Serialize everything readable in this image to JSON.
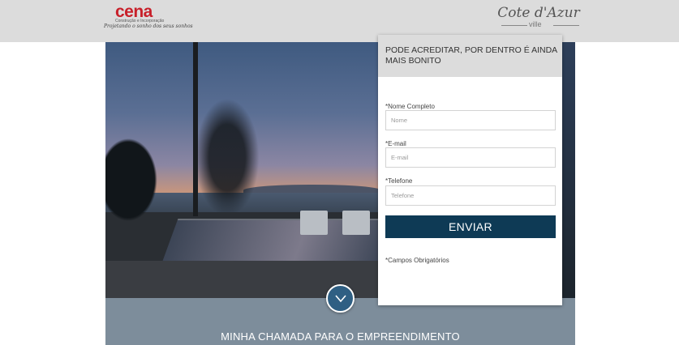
{
  "header": {
    "brand_left": {
      "name": "cena",
      "subtitle": "Construção e Incorporação",
      "tagline": "Projetando o sonho dos seus sonhos"
    },
    "brand_right": {
      "name": "Cote d'Azur",
      "sub": "ville"
    }
  },
  "form": {
    "title": "PODE ACREDITAR, POR DENTRO É AINDA MAIS BONITO",
    "fields": [
      {
        "label": "*Nome Completo",
        "placeholder": "Nome"
      },
      {
        "label": "*E-mail",
        "placeholder": "E-mail"
      },
      {
        "label": "*Telefone",
        "placeholder": "Telefone"
      }
    ],
    "submit_label": "ENVIAR",
    "required_note": "*Campos Obrigatórios"
  },
  "band": {
    "title": "MINHA CHAMADA PARA O EMPREENDIMENTO"
  },
  "colors": {
    "accent": "#0e3a55",
    "brand_red": "#c8202a",
    "header_bg": "#dcdcdc",
    "band_bg": "#7d8d9b",
    "scroll_button": "#2f5f83"
  },
  "icons": {
    "scroll": "chevron-down-icon"
  }
}
